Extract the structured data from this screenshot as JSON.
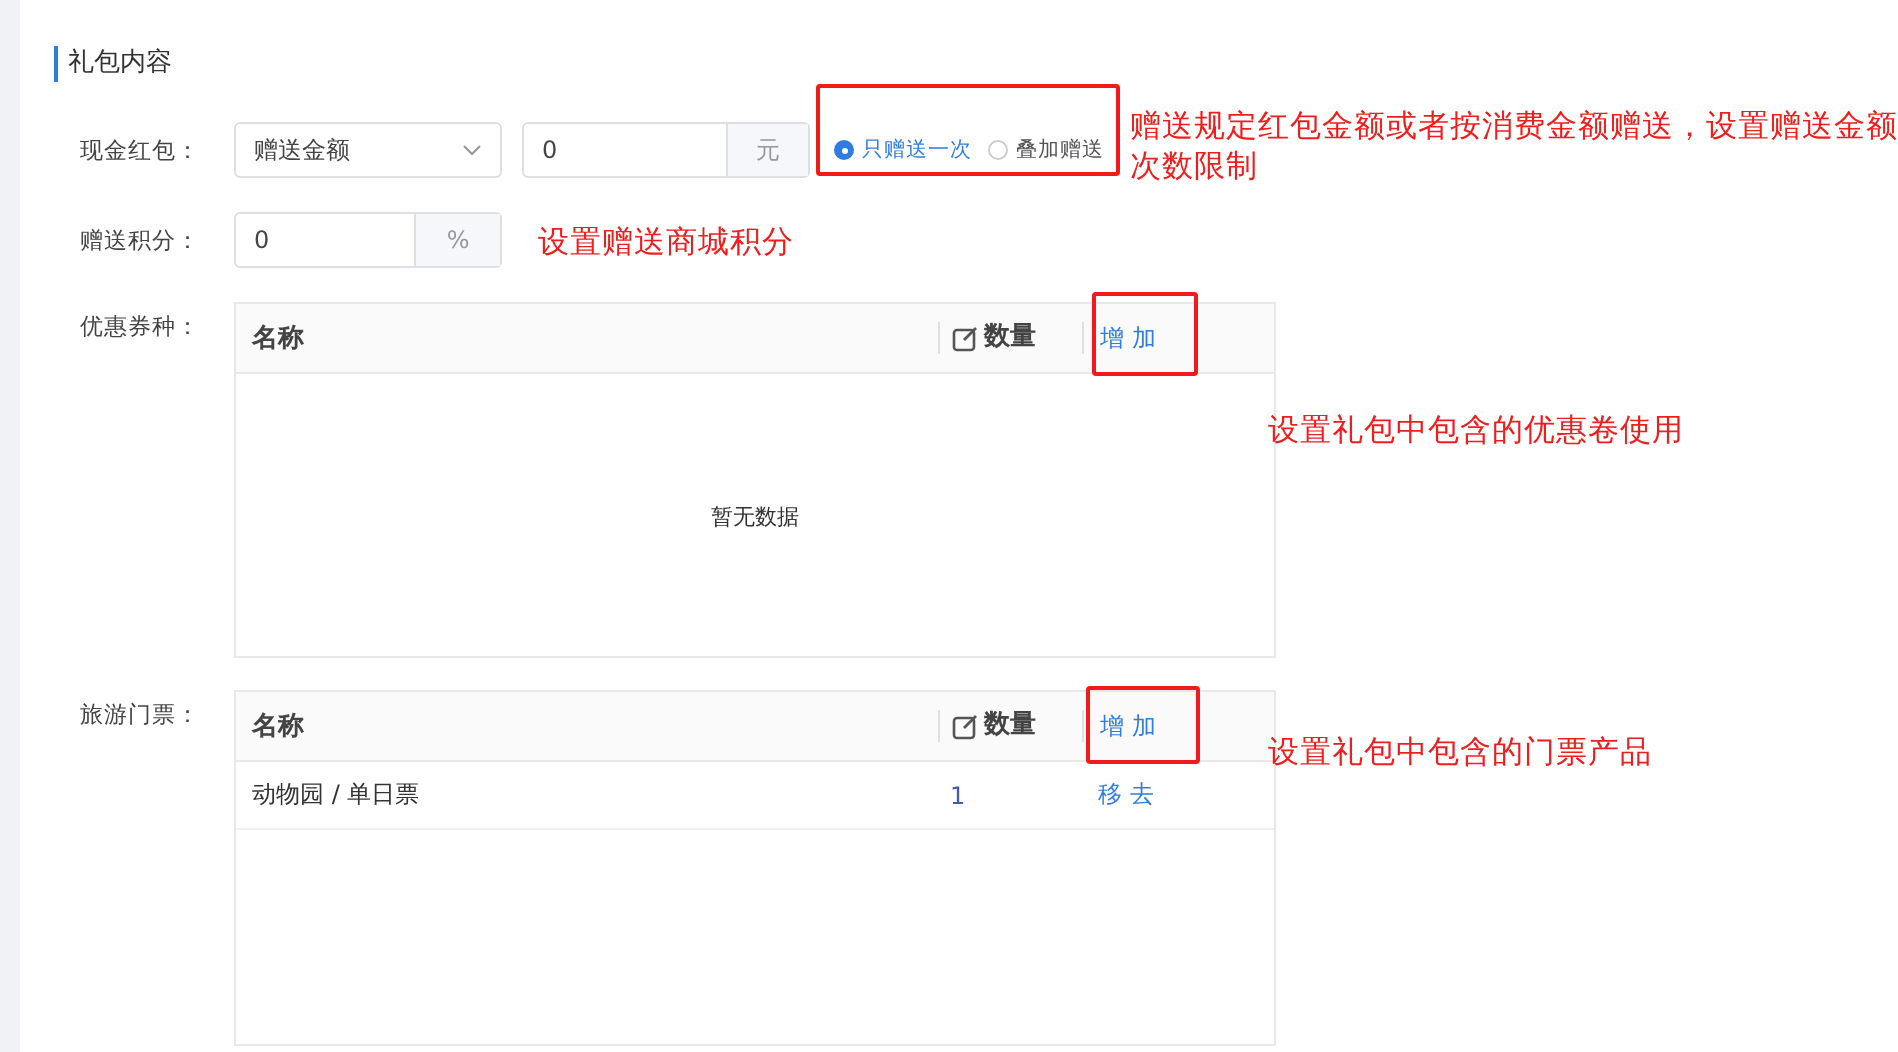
{
  "section_title": "礼包内容",
  "cash_bonus": {
    "label": "现金红包：",
    "mode_select": {
      "value": "赠送金额"
    },
    "amount": {
      "value": "0",
      "unit": "元"
    },
    "options": [
      {
        "label": "只赠送一次",
        "selected": true
      },
      {
        "label": "叠加赠送",
        "selected": false
      }
    ]
  },
  "points": {
    "label": "赠送积分：",
    "value": "0",
    "unit": "%"
  },
  "coupons": {
    "label": "优惠券种：",
    "columns": [
      "名称",
      "数量"
    ],
    "add_label": "增 加",
    "empty_text": "暂无数据"
  },
  "tickets": {
    "label": "旅游门票：",
    "columns": [
      "名称",
      "数量"
    ],
    "add_label": "增 加",
    "rows": [
      {
        "name": "动物园 / 单日票",
        "quantity": "1",
        "action": "移 去"
      }
    ]
  },
  "annotations": [
    {
      "text": "赠送规定红包金额或者按消费金额赠送，设置赠送金额次数限制"
    },
    {
      "text": "设置赠送商城积分"
    },
    {
      "text": "设置礼包中包含的优惠卷使用"
    },
    {
      "text": "设置礼包中包含的门票产品"
    }
  ]
}
